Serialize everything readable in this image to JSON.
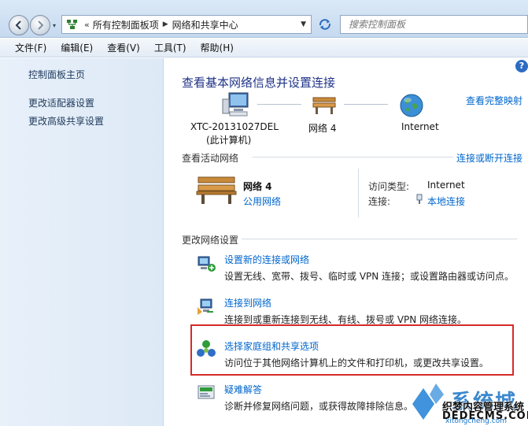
{
  "address_bar": {
    "crumbs": [
      "所有控制面板项",
      "网络和共享中心"
    ],
    "history_glyph": "▾",
    "prefix_glyph": "«",
    "search_placeholder": "搜索控制面板"
  },
  "menu": [
    "文件(F)",
    "编辑(E)",
    "查看(V)",
    "工具(T)",
    "帮助(H)"
  ],
  "left_pane": {
    "links": [
      "控制面板主页",
      "更改适配器设置",
      "更改高级共享设置"
    ]
  },
  "main": {
    "help_glyph": "?",
    "title": "查看基本网络信息并设置连接",
    "full_map_link": "查看完整映射",
    "map": {
      "computer_name": "XTC-20131027DEL",
      "computer_note": "(此计算机)",
      "network": "网络  4",
      "internet": "Internet"
    },
    "active_section": {
      "heading": "查看活动网络",
      "connect_link": "连接或断开连接",
      "network_name": "网络  4",
      "network_type": "公用网络",
      "access_type_label": "访问类型:",
      "access_type_value": "Internet",
      "connections_label": "连接:",
      "connections_value": "本地连接"
    },
    "change_section": {
      "heading": "更改网络设置",
      "tasks": [
        {
          "title": "设置新的连接或网络",
          "desc": "设置无线、宽带、拨号、临时或 VPN 连接；或设置路由器或访问点。",
          "icon": "new-connection-icon"
        },
        {
          "title": "连接到网络",
          "desc": "连接到或重新连接到无线、有线、拨号或 VPN 网络连接。",
          "icon": "connect-network-icon"
        },
        {
          "title": "选择家庭组和共享选项",
          "desc": "访问位于其他网络计算机上的文件和打印机，或更改共享设置。",
          "icon": "homegroup-icon"
        },
        {
          "title": "疑难解答",
          "desc": "诊断并修复网络问题，或获得故障排除信息。",
          "icon": "troubleshoot-icon"
        }
      ]
    }
  },
  "watermark": {
    "big": "系统城",
    "line1": "织梦内容管理系统",
    "line2": "DEDECMS.COM",
    "line3": "xitongcheng.com"
  },
  "colors": {
    "link": "#0066cc",
    "title": "#1e3287",
    "highlight": "#d62a2a"
  }
}
